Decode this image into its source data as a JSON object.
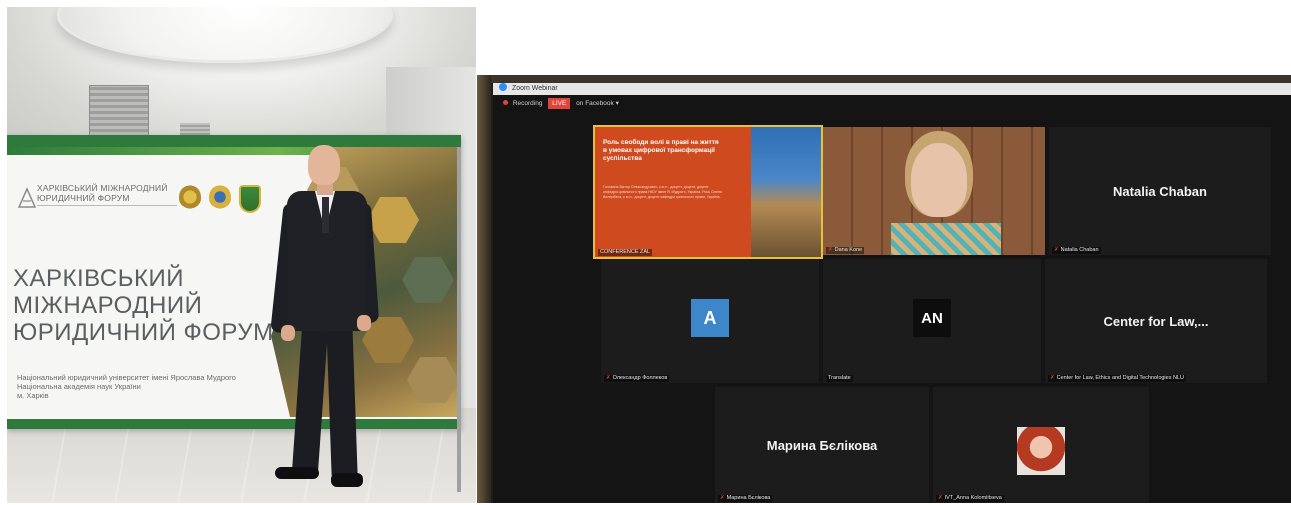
{
  "left_photo": {
    "banner": {
      "small_title_line1": "ХАРКІВСЬКИЙ МІЖНАРОДНИЙ",
      "small_title_line2": "ЮРИДИЧНИЙ ФОРУМ",
      "big_title_line1": "ХАРКІВСЬКИЙ",
      "big_title_line2": "МІЖНАРОДНИЙ",
      "big_title_line3": "ЮРИДИЧНИЙ ФОРУМ",
      "sub_line1": "Національний юридичний університет імені Ярослава Мудрого",
      "sub_line2": "Національна академія наук України",
      "sub_line3": "м. Харків",
      "brand_color": "#2e7a3c"
    }
  },
  "zoom": {
    "window_title": "Zoom Webinar",
    "recording_label": "Recording",
    "live_label": "LIVE",
    "stream_target": "on Facebook",
    "tiles": {
      "slide": {
        "label": "CONFERENCE ZAL",
        "title": "Роль свободи волі в праві на життя в умовах цифрової трансформації суспільства",
        "body": "Головань Віктор Олександрович, к.ю.н., доцент, доцент, доцент кафедри цивільного права НЮУ імені Я. Мудрого, Україна. Рось Олена Валеріївна, к.ю.н., доцент, доцент кафедри цивільного права, Україна.",
        "accent": "#cf4a1e"
      },
      "dana": {
        "label": "Dana Kone"
      },
      "natalia": {
        "name": "Natalia Chaban",
        "label": "Natalia Chaban"
      },
      "oleksandr": {
        "avatar_letter": "A",
        "avatar_color": "#3c86c9",
        "label": "Олександр Фоллеков"
      },
      "translate": {
        "avatar_letters": "AN",
        "avatar_color": "#111111",
        "label": "Translate"
      },
      "center": {
        "name": "Center for Law,...",
        "label": "Center for Law, Ethics and Digital Technologies NLU"
      },
      "maryna": {
        "name": "Марина Бєлікова",
        "label": "Марина Бєлікова"
      },
      "anna": {
        "label": "IVT_Anna Kolomiitseva"
      }
    }
  }
}
